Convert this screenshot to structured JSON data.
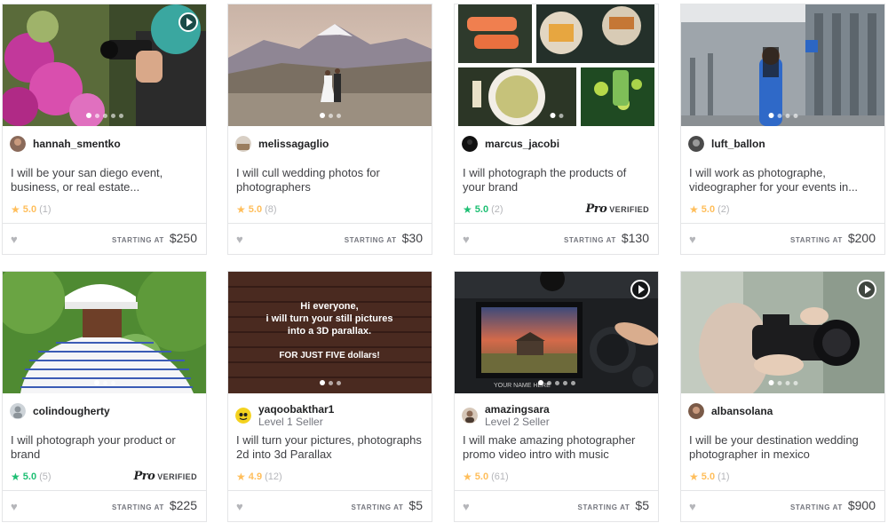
{
  "footer_label": "STARTING AT",
  "pro_label": "Pro",
  "verified_label": "VERIFIED",
  "gigs": [
    {
      "seller": "hannah_smentko",
      "level": "",
      "title": "I will be your san diego event, business, or real estate...",
      "rating": "5.0",
      "reviews": "(1)",
      "price": "$250",
      "pro": false,
      "video": true,
      "star_color": "gold",
      "thumb": "flowers-photographer"
    },
    {
      "seller": "melissagaglio",
      "level": "",
      "title": "I will cull wedding photos for photographers",
      "rating": "5.0",
      "reviews": "(8)",
      "price": "$30",
      "pro": false,
      "video": false,
      "star_color": "gold",
      "thumb": "mountain-wedding"
    },
    {
      "seller": "marcus_jacobi",
      "level": "",
      "title": "I will photograph the products of your brand",
      "rating": "5.0",
      "reviews": "(2)",
      "price": "$130",
      "pro": true,
      "video": false,
      "star_color": "teal",
      "thumb": "food-collage"
    },
    {
      "seller": "luft_ballon",
      "level": "",
      "title": "I will work as photographe, videographer for your events in...",
      "rating": "5.0",
      "reviews": "(2)",
      "price": "$200",
      "pro": false,
      "video": false,
      "star_color": "gold",
      "thumb": "woman-building"
    },
    {
      "seller": "colindougherty",
      "level": "",
      "title": "I will photograph your product or brand",
      "rating": "5.0",
      "reviews": "(5)",
      "price": "$225",
      "pro": true,
      "video": false,
      "star_color": "teal",
      "thumb": "golfer-back"
    },
    {
      "seller": "yaqoobakthar1",
      "level": "Level 1 Seller",
      "title": "I will turn your pictures, photographs 2d into 3d Parallax",
      "rating": "4.9",
      "reviews": "(12)",
      "price": "$5",
      "pro": false,
      "video": false,
      "star_color": "gold",
      "thumb": "parallax-brick",
      "thumb_lines": [
        "Hi everyone,",
        "i will turn your still pictures",
        "into a 3D parallax.",
        "FOR JUST FIVE dollars!"
      ]
    },
    {
      "seller": "amazingsara",
      "level": "Level 2 Seller",
      "title": "I will make amazing photographer promo video intro with music",
      "rating": "5.0",
      "reviews": "(61)",
      "price": "$5",
      "pro": false,
      "video": true,
      "star_color": "gold",
      "thumb": "camera-screen",
      "thumb_caption": "YOUR NAME HERE"
    },
    {
      "seller": "albansolana",
      "level": "",
      "title": "I will be your destination wedding photographer in mexico",
      "rating": "5.0",
      "reviews": "(1)",
      "price": "$900",
      "pro": false,
      "video": true,
      "star_color": "gold",
      "thumb": "camera-hands"
    }
  ],
  "colors": {
    "gold_star": "#ffbe5b",
    "teal_star": "#1dbf73",
    "border": "#e4e5e7",
    "text": "#404145"
  }
}
